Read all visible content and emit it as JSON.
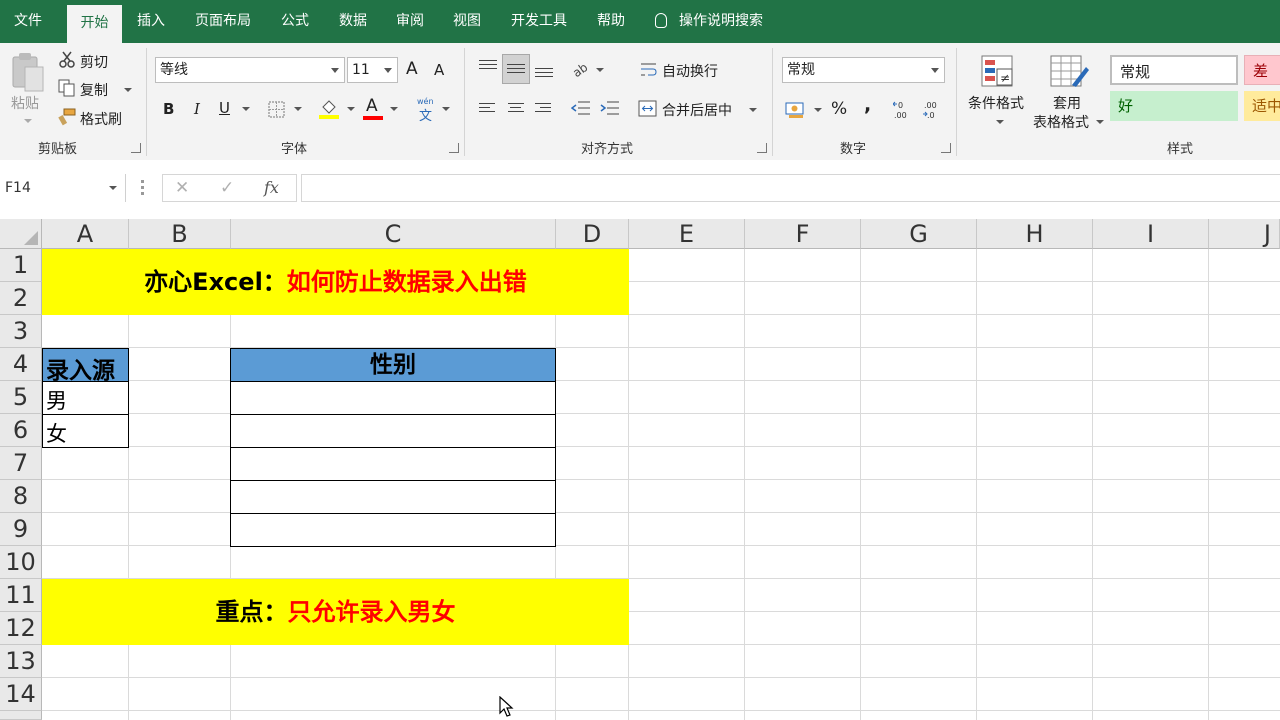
{
  "tabs": [
    "文件",
    "开始",
    "插入",
    "页面布局",
    "公式",
    "数据",
    "审阅",
    "视图",
    "开发工具",
    "帮助"
  ],
  "active_tab": "开始",
  "tell_me": "操作说明搜索",
  "ribbon": {
    "clipboard": {
      "paste": "粘贴",
      "cut": "剪切",
      "copy": "复制",
      "format_painter": "格式刷",
      "label": "剪贴板"
    },
    "font": {
      "font_name": "等线",
      "font_size": "11",
      "bold": "B",
      "italic": "I",
      "underline": "U",
      "grow": "A",
      "shrink": "A",
      "font_color_glyph": "A",
      "phonetic": "wén",
      "phonetic_char": "文",
      "label": "字体"
    },
    "alignment": {
      "wrap_text": "自动换行",
      "merge_center": "合并后居中",
      "label": "对齐方式"
    },
    "number": {
      "format": "常规",
      "percent": "%",
      "comma": ",",
      "label": "数字"
    },
    "styles": {
      "conditional": "条件格式",
      "table_format_1": "套用",
      "table_format_2": "表格格式",
      "normal": "常规",
      "bad": "差",
      "good": "好",
      "neutral": "适中",
      "label": "样式"
    }
  },
  "formula_bar": {
    "name_box": "F14",
    "cancel": "✕",
    "enter": "✓",
    "fx": "fx",
    "value": ""
  },
  "columns": [
    "A",
    "B",
    "C",
    "D",
    "E",
    "F",
    "G",
    "H",
    "I",
    "J"
  ],
  "rows": [
    "1",
    "2",
    "3",
    "4",
    "5",
    "6",
    "7",
    "8",
    "9",
    "10",
    "11",
    "12",
    "13",
    "14"
  ],
  "cells": {
    "title_black": "亦心Excel：",
    "title_red": "如何防止数据录入出错",
    "source_header": "录入源",
    "source_1": "男",
    "source_2": "女",
    "gender_header": "性别",
    "note_black": "重点：",
    "note_red": "只允许录入男女"
  },
  "colors": {
    "excel_green": "#217346",
    "highlight_yellow": "#ffff00",
    "header_blue": "#5b9bd5",
    "title_red": "#ff0000"
  }
}
